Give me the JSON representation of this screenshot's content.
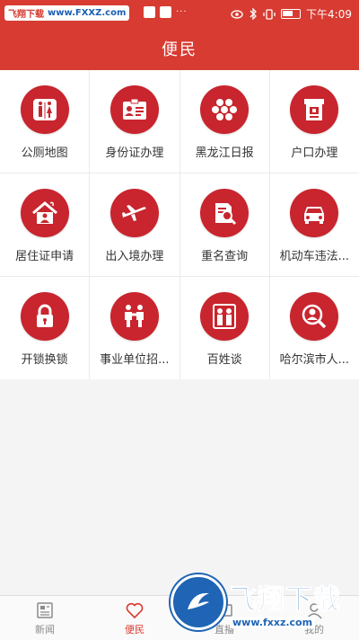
{
  "status_bar": {
    "watermark_a": "飞翔下载",
    "watermark_b": "www.FXXZ.com",
    "time": "下午4:09"
  },
  "header": {
    "title": "便民"
  },
  "grid": {
    "items": [
      {
        "label": "公厕地图",
        "icon": "restroom-icon"
      },
      {
        "label": "身份证办理",
        "icon": "id-card-icon"
      },
      {
        "label": "黑龙江日报",
        "icon": "hexagon-icon"
      },
      {
        "label": "户口办理",
        "icon": "household-register-icon"
      },
      {
        "label": "居住证申请",
        "icon": "house-icon"
      },
      {
        "label": "出入境办理",
        "icon": "airplane-icon"
      },
      {
        "label": "重名查询",
        "icon": "document-search-icon"
      },
      {
        "label": "机动车违法...",
        "icon": "car-icon"
      },
      {
        "label": "开锁换锁",
        "icon": "lock-icon"
      },
      {
        "label": "事业单位招...",
        "icon": "handshake-icon"
      },
      {
        "label": "百姓谈",
        "icon": "people-icon"
      },
      {
        "label": "哈尔滨市人...",
        "icon": "person-search-icon"
      }
    ]
  },
  "bottom_nav": {
    "items": [
      {
        "label": "新闻",
        "icon": "news-icon",
        "active": false
      },
      {
        "label": "便民",
        "icon": "heart-icon",
        "active": true
      },
      {
        "label": "直播",
        "icon": "live-icon",
        "active": false
      },
      {
        "label": "我的",
        "icon": "user-icon",
        "active": false
      }
    ]
  },
  "watermark_bottom": {
    "big": "飞翔下载",
    "small": "www.fxxz.com"
  },
  "colors": {
    "primary": "#d83b31",
    "icon_circle": "#c8252e",
    "watermark_blue": "#1f64b5"
  }
}
